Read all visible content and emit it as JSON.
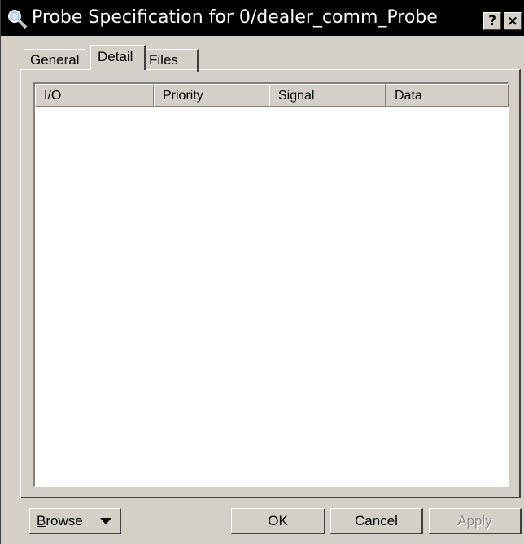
{
  "window": {
    "title": "Probe Specification for 0/dealer_comm_Probe",
    "help_button": "?",
    "close_button": "×",
    "icon": "magnifier-probe-icon"
  },
  "tabs": [
    {
      "label": "General",
      "selected": false
    },
    {
      "label": "Detail",
      "selected": true
    },
    {
      "label": "Files",
      "selected": false
    }
  ],
  "listview": {
    "columns": [
      "I/O",
      "Priority",
      "Signal",
      "Data"
    ],
    "rows": []
  },
  "buttons": {
    "browse_first": "B",
    "browse_rest": "rowse",
    "ok": "OK",
    "cancel": "Cancel",
    "apply": "Apply",
    "apply_enabled": false
  },
  "colors": {
    "face": "#d4d0c8",
    "titlebar": "#000000",
    "list_background": "#ffffff"
  }
}
